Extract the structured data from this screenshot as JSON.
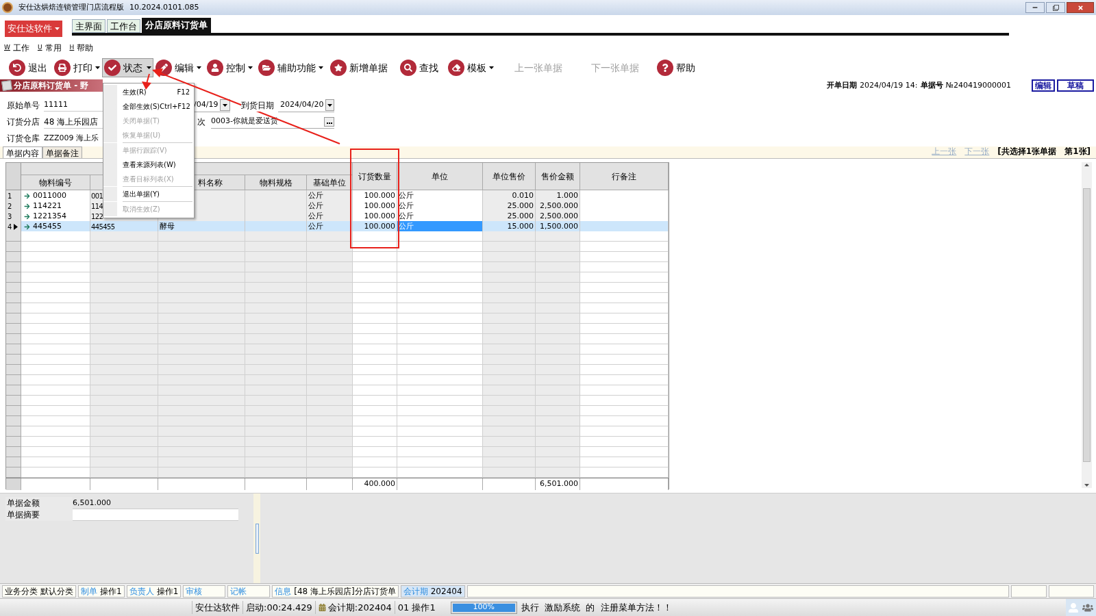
{
  "window": {
    "title": "安仕达烘焙连锁管理门店流程版",
    "version": "10.2024.0101.085"
  },
  "brand_button": "安仕达软件",
  "page_tabs": [
    {
      "label": "主界面",
      "selected": false
    },
    {
      "label": "工作台",
      "selected": false
    },
    {
      "label": "分店原料订货单",
      "selected": true
    }
  ],
  "menu": [
    {
      "key": "W",
      "label": "工作"
    },
    {
      "key": "U",
      "label": "常用"
    },
    {
      "key": "H",
      "label": "帮助"
    }
  ],
  "toolbar": [
    {
      "label": "退出",
      "dropdown": false,
      "disabled": false,
      "pressed": false
    },
    {
      "label": "打印",
      "dropdown": true,
      "disabled": false,
      "pressed": false
    },
    {
      "label": "状态",
      "dropdown": true,
      "disabled": false,
      "pressed": true
    },
    {
      "label": "编辑",
      "dropdown": true,
      "disabled": false,
      "pressed": false
    },
    {
      "label": "控制",
      "dropdown": true,
      "disabled": false,
      "pressed": false
    },
    {
      "label": "辅助功能",
      "dropdown": true,
      "disabled": false,
      "pressed": false
    },
    {
      "label": "新增单据",
      "dropdown": false,
      "disabled": false,
      "pressed": false
    },
    {
      "label": "查找",
      "dropdown": false,
      "disabled": false,
      "pressed": false
    },
    {
      "label": "模板",
      "dropdown": true,
      "disabled": false,
      "pressed": false
    },
    {
      "label": "上一张单据",
      "dropdown": false,
      "disabled": true,
      "pressed": false
    },
    {
      "label": "下一张单据",
      "dropdown": false,
      "disabled": true,
      "pressed": false
    },
    {
      "label": "帮助",
      "dropdown": false,
      "disabled": false,
      "pressed": false
    }
  ],
  "document": {
    "title": "分店原料订货单 - 野",
    "open_date_label": "开单日期",
    "open_date": "2024/04/19 14:",
    "number_label": "单据号",
    "number": "№240419000001",
    "buttons": [
      "编辑",
      "草稿"
    ]
  },
  "form": {
    "original_no": {
      "label": "原始单号",
      "value": "11111"
    },
    "branch": {
      "label": "订货分店",
      "value": "48 海上乐园店"
    },
    "warehouse": {
      "label": "订货仓库",
      "value": "ZZZ009 海上乐"
    },
    "order_date": {
      "value": "/04/19"
    },
    "arrival_date": {
      "label": "到货日期",
      "value": "2024/04/20"
    },
    "batch": {
      "label": "次",
      "value": "0003-你就是爱送货"
    }
  },
  "content_tabs": [
    {
      "label": "单据内容",
      "selected": true
    },
    {
      "label": "单据备注",
      "selected": false
    }
  ],
  "pager": {
    "prev": "上一张",
    "next": "下一张",
    "summary": "[共选择1张单据　第1张]"
  },
  "table": {
    "columns": [
      {
        "label": "物料编号",
        "editable": true
      },
      {
        "editable": false
      },
      {
        "label": "料名称",
        "editable": false
      },
      {
        "label": "物料规格",
        "editable": false
      },
      {
        "label": "基础单位",
        "editable": false
      },
      {
        "label": "订货数量",
        "editable": true
      },
      {
        "label": "单位",
        "editable": true
      },
      {
        "label": "单位售价",
        "editable": false
      },
      {
        "label": "售价金额",
        "editable": false
      },
      {
        "label": "行备注",
        "editable": true
      }
    ],
    "rows": [
      {
        "number": "1",
        "selected": false,
        "cells": [
          {
            "text": "0011000",
            "focused": false
          },
          {
            "text": "001",
            "focused": false
          },
          {
            "focused": false
          },
          {
            "focused": false
          },
          {
            "text": "公斤",
            "focused": false
          },
          {
            "text": "100.000",
            "focused": false
          },
          {
            "text": "公斤",
            "focused": false
          },
          {
            "text": "0.010",
            "focused": false
          },
          {
            "text": "1.000",
            "focused": false
          },
          {
            "focused": false
          }
        ]
      },
      {
        "number": "2",
        "selected": false,
        "cells": [
          {
            "text": "114221",
            "focused": false
          },
          {
            "text": "114",
            "focused": false
          },
          {
            "focused": false
          },
          {
            "focused": false
          },
          {
            "text": "公斤",
            "focused": false
          },
          {
            "text": "100.000",
            "focused": false
          },
          {
            "text": "公斤",
            "focused": false
          },
          {
            "text": "25.000",
            "focused": false
          },
          {
            "text": "2,500.000",
            "focused": false
          },
          {
            "focused": false
          }
        ]
      },
      {
        "number": "3",
        "selected": false,
        "cells": [
          {
            "text": "1221354",
            "focused": false
          },
          {
            "text": "122",
            "focused": false
          },
          {
            "focused": false
          },
          {
            "focused": false
          },
          {
            "text": "公斤",
            "focused": false
          },
          {
            "text": "100.000",
            "focused": false
          },
          {
            "text": "公斤",
            "focused": false
          },
          {
            "text": "25.000",
            "focused": false
          },
          {
            "text": "2,500.000",
            "focused": false
          },
          {
            "focused": false
          }
        ]
      },
      {
        "number": "4",
        "selected": true,
        "cells": [
          {
            "text": "445455",
            "focused": false
          },
          {
            "text": "445455",
            "focused": false
          },
          {
            "text": "酵母",
            "focused": false
          },
          {
            "focused": false
          },
          {
            "text": "公斤",
            "focused": false
          },
          {
            "text": "100.000",
            "focused": false
          },
          {
            "text": "公斤",
            "focused": true
          },
          {
            "text": "15.000",
            "focused": false
          },
          {
            "text": "1,500.000",
            "focused": false
          },
          {
            "focused": false
          }
        ]
      }
    ],
    "totals": {
      "quantity": "400.000",
      "amount": "6,501.000"
    }
  },
  "summary": [
    {
      "label": "单据金额",
      "value": "6,501.000"
    },
    {
      "label": "单据摘要"
    }
  ],
  "status_fields": [
    {
      "kind": "plain",
      "label": "业务分类",
      "value": "默认分类",
      "selected": false
    },
    {
      "kind": "tagged",
      "label": "制单",
      "value": "操作1",
      "selected": false
    },
    {
      "kind": "tagged",
      "label": "负责人",
      "value": "操作1",
      "selected": false
    },
    {
      "kind": "tagged",
      "label": "审核",
      "selected": false
    },
    {
      "kind": "tagged",
      "label": "记帐",
      "selected": false
    },
    {
      "kind": "tagged",
      "label": "信息",
      "value": "[48 海上乐园店]分店订货单",
      "selected": false
    },
    {
      "kind": "tagged",
      "label": "会计期",
      "value": "202404",
      "selected": true
    }
  ],
  "status_bar": {
    "company": "安仕达软件",
    "uptime": "启动:00:24.429",
    "period": "会计期:202404",
    "user": "01 操作1",
    "progress": {
      "level": 1,
      "reading": "100%"
    },
    "message": "执行  激励系统  的  注册菜单方法！！"
  },
  "context_menu": [
    {
      "label": "生效(R)",
      "shortcut": "F12",
      "disabled": false,
      "separator_after": false
    },
    {
      "label": "全部生效(S)",
      "shortcut": "Ctrl+F12",
      "disabled": false,
      "separator_after": false
    },
    {
      "label": "关闭单据(T)",
      "disabled": true,
      "separator_after": false
    },
    {
      "label": "恢复单据(U)",
      "disabled": true,
      "separator_after": true
    },
    {
      "label": "单据行跟踪(V)",
      "disabled": true,
      "separator_after": false
    },
    {
      "label": "查看来源列表(W)",
      "disabled": false,
      "separator_after": false
    },
    {
      "label": "查看目标列表(X)",
      "disabled": true,
      "separator_after": true
    },
    {
      "label": "退出单据(Y)",
      "disabled": false,
      "separator_after": true
    },
    {
      "label": "取消生效(Z)",
      "disabled": true,
      "separator_after": false
    }
  ]
}
